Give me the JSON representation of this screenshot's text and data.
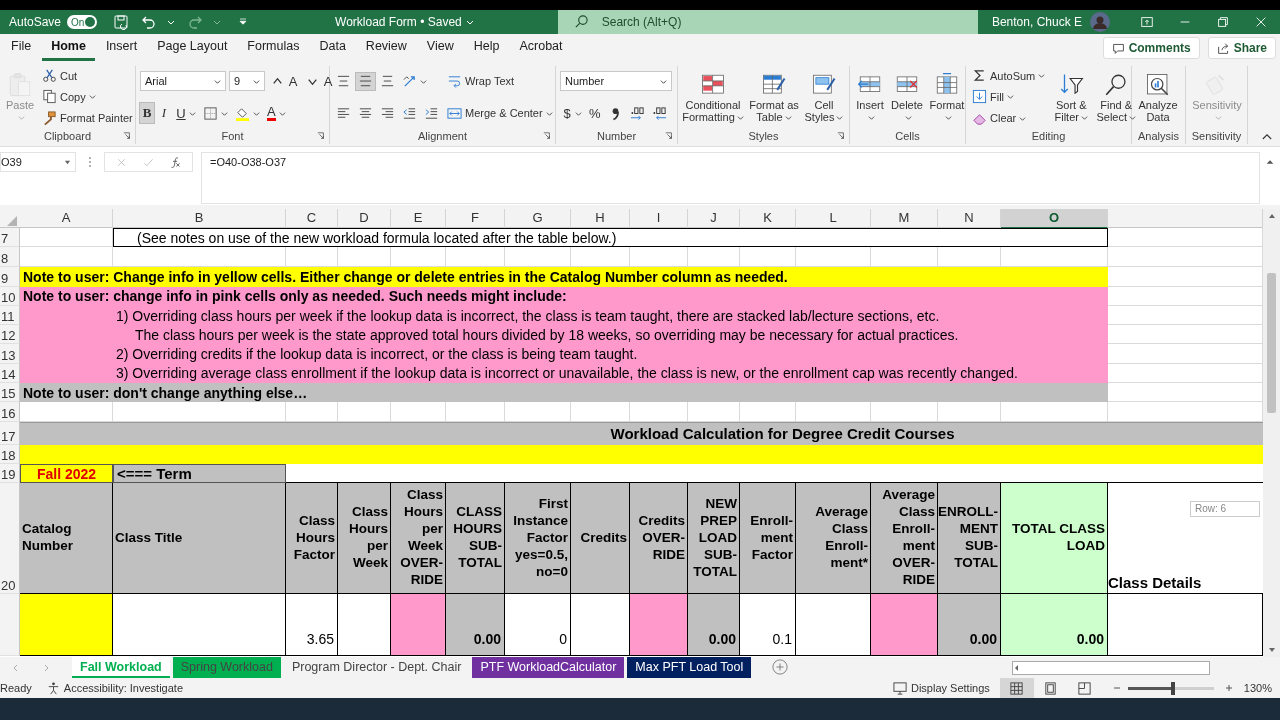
{
  "title_bar": {
    "autosave_label": "AutoSave",
    "autosave": {
      "on": true,
      "label": "On"
    },
    "title": "Workload Form • Saved",
    "search": {
      "placeholder": "Search (Alt+Q)"
    },
    "user": "Benton, Chuck E"
  },
  "menu_tabs": [
    {
      "label": "File",
      "selected": false
    },
    {
      "label": "Home",
      "selected": true
    },
    {
      "label": "Insert",
      "selected": false
    },
    {
      "label": "Page Layout",
      "selected": false
    },
    {
      "label": "Formulas",
      "selected": false
    },
    {
      "label": "Data",
      "selected": false
    },
    {
      "label": "Review",
      "selected": false
    },
    {
      "label": "View",
      "selected": false
    },
    {
      "label": "Help",
      "selected": false
    },
    {
      "label": "Acrobat",
      "selected": false
    }
  ],
  "comments": "Comments",
  "share": "Share",
  "ribbon": [
    {
      "label": "Clipboard",
      "launcher": true,
      "columns": [
        [
          [
            {
              "kind": "paste",
              "label": "Paste",
              "disabled": true,
              "menu": true
            }
          ]
        ],
        [
          [
            {
              "kind": "cut",
              "label": "Cut",
              "disabled": false
            }
          ],
          [
            {
              "kind": "copy",
              "label": "Copy",
              "disabled": false,
              "menu": true
            }
          ],
          [
            {
              "kind": "format-painter",
              "label": "Format Painter",
              "disabled": false
            }
          ]
        ]
      ]
    },
    {
      "label": "Font",
      "launcher": true,
      "columns": [
        [
          [
            {
              "kind": "font-name",
              "value": "Arial"
            },
            {
              "kind": "font-size",
              "value": "9"
            },
            {
              "kind": "grow-font",
              "label": "A",
              "disabled": false
            },
            {
              "kind": "shrink-font",
              "label": "A",
              "disabled": false
            }
          ],
          [
            {
              "kind": "bold",
              "label": "B",
              "on": true,
              "disabled": false
            },
            {
              "kind": "italic",
              "label": "I",
              "on": false,
              "disabled": false
            },
            {
              "kind": "underline",
              "label": "U",
              "on": false,
              "disabled": false,
              "menu": true
            },
            {
              "kind": "borders",
              "disabled": false,
              "menu": true
            },
            {
              "kind": "fill-color",
              "disabled": false,
              "menu": true
            },
            {
              "kind": "font-color",
              "label": "A",
              "disabled": false,
              "menu": true
            }
          ]
        ]
      ]
    },
    {
      "label": "Alignment",
      "launcher": true,
      "columns": [
        [
          [
            {
              "kind": "align-top",
              "on": false,
              "disabled": false
            },
            {
              "kind": "align-middle",
              "on": true,
              "disabled": false
            },
            {
              "kind": "align-bottom",
              "on": false,
              "disabled": false
            },
            {
              "kind": "orientation",
              "disabled": false,
              "menu": true
            }
          ],
          [
            {
              "kind": "align-left",
              "on": false,
              "disabled": false
            },
            {
              "kind": "align-center",
              "on": false,
              "disabled": false
            },
            {
              "kind": "align-right",
              "on": false,
              "disabled": false
            },
            {
              "kind": "decrease-indent",
              "disabled": false
            },
            {
              "kind": "increase-indent",
              "disabled": false
            }
          ]
        ],
        [
          [
            {
              "kind": "wrap-text",
              "label": "Wrap Text",
              "disabled": false
            }
          ],
          [
            {
              "kind": "merge-center",
              "label": "Merge & Center",
              "disabled": false,
              "menu": true
            }
          ]
        ]
      ]
    },
    {
      "label": "Number",
      "launcher": true,
      "columns": [
        [
          [
            {
              "kind": "number-format",
              "value": "Number"
            }
          ],
          [
            {
              "kind": "currency",
              "label": "$",
              "disabled": false,
              "menu": true
            },
            {
              "kind": "percent",
              "label": "%",
              "disabled": false
            },
            {
              "kind": "comma-style",
              "disabled": false
            },
            {
              "kind": "increase-decimal",
              "disabled": false
            },
            {
              "kind": "decrease-decimal",
              "disabled": false
            }
          ]
        ]
      ]
    },
    {
      "label": "Styles",
      "launcher": true,
      "columns": [
        [
          [
            {
              "kind": "conditional-formatting",
              "label": "Conditional Formatting",
              "disabled": false,
              "menu": true
            }
          ]
        ],
        [
          [
            {
              "kind": "format-as-table",
              "label": "Format as Table",
              "disabled": false,
              "menu": true
            }
          ]
        ],
        [
          [
            {
              "kind": "cell-styles",
              "label": "Cell Styles",
              "disabled": false,
              "menu": true
            }
          ]
        ]
      ]
    },
    {
      "label": "Cells",
      "columns": [
        [
          [
            {
              "kind": "insert",
              "label": "Insert",
              "disabled": false,
              "menu": true
            }
          ]
        ],
        [
          [
            {
              "kind": "delete",
              "label": "Delete",
              "disabled": false,
              "menu": true
            }
          ]
        ],
        [
          [
            {
              "kind": "format",
              "label": "Format",
              "disabled": false,
              "menu": true
            }
          ]
        ]
      ]
    },
    {
      "label": "Editing",
      "columns": [
        [
          [
            {
              "kind": "autosum",
              "label": "AutoSum",
              "disabled": false,
              "menu": true
            }
          ],
          [
            {
              "kind": "fill",
              "label": "Fill",
              "disabled": false,
              "menu": true
            }
          ],
          [
            {
              "kind": "clear",
              "label": "Clear",
              "disabled": false,
              "menu": true
            }
          ]
        ],
        [
          [
            {
              "kind": "sort-filter",
              "label": "Sort & Filter",
              "disabled": false,
              "menu": true
            }
          ]
        ],
        [
          [
            {
              "kind": "find-select",
              "label": "Find & Select",
              "disabled": false,
              "menu": true
            }
          ]
        ]
      ]
    },
    {
      "label": "Analysis",
      "columns": [
        [
          [
            {
              "kind": "analyze-data",
              "label": "Analyze Data",
              "disabled": false
            }
          ]
        ]
      ]
    },
    {
      "label": "Sensitivity",
      "columns": [
        [
          [
            {
              "kind": "sensitivity",
              "label": "Sensitivity",
              "disabled": true,
              "menu": true
            }
          ]
        ]
      ]
    }
  ],
  "formula_bar": {
    "name_box": "O39",
    "formula": "=O40-O38-O37"
  },
  "columns": [
    {
      "label": "A",
      "selected": false
    },
    {
      "label": "B",
      "selected": false
    },
    {
      "label": "C",
      "selected": false
    },
    {
      "label": "D",
      "selected": false
    },
    {
      "label": "E",
      "selected": false
    },
    {
      "label": "F",
      "selected": false
    },
    {
      "label": "G",
      "selected": false
    },
    {
      "label": "H",
      "selected": false
    },
    {
      "label": "I",
      "selected": false
    },
    {
      "label": "J",
      "selected": false
    },
    {
      "label": "K",
      "selected": false
    },
    {
      "label": "L",
      "selected": false
    },
    {
      "label": "M",
      "selected": false
    },
    {
      "label": "N",
      "selected": false
    },
    {
      "label": "O",
      "selected": true
    }
  ],
  "rows": [
    {
      "num": "7",
      "cells": [
        {
          "kind": "white"
        },
        {
          "kind": "boxed",
          "text": "(See notes on use of the new workload formula located after the table below.)"
        }
      ]
    },
    {
      "num": "8"
    },
    {
      "num": "9",
      "cells": [
        {
          "kind": "note-yellow",
          "text": "Note to user: Change info in yellow cells.  Either change or delete entries in the Catalog Number column as needed."
        }
      ]
    },
    {
      "num": "10",
      "cells": [
        {
          "kind": "note-pink",
          "text": "Note to user: change info in pink cells only as needed.  Such needs might include:"
        }
      ]
    },
    {
      "num": "11",
      "cells": [
        {
          "kind": "pink"
        },
        {
          "kind": "pink-text",
          "text": "1) Overriding class hours per week if the lookup data is incorrect, the class is team taught, there are stacked lab/lecture sections, etc."
        }
      ]
    },
    {
      "num": "12",
      "cells": [
        {
          "kind": "pink"
        },
        {
          "kind": "pink-text-indent",
          "text": "The class hours per week is the state approved total hours divided by 18 weeks, so overriding may be necessary for actual practices."
        }
      ]
    },
    {
      "num": "13",
      "cells": [
        {
          "kind": "pink"
        },
        {
          "kind": "pink-text",
          "text": "2) Overriding credits if the lookup data is incorrect, or the class is being team taught."
        }
      ]
    },
    {
      "num": "14",
      "cells": [
        {
          "kind": "pink"
        },
        {
          "kind": "pink-text",
          "text": "3) Overriding average class enrollment if the lookup data is incorrect or unavailable, the class is new, or the enrollment cap was recently changed."
        }
      ]
    },
    {
      "num": "15",
      "cells": [
        {
          "kind": "note-grey",
          "text": "Note to user: don't change anything else…"
        }
      ]
    },
    {
      "num": "16"
    },
    {
      "num": "17",
      "cells": [
        {
          "kind": "banner",
          "text": "Workload Calculation for Degree Credit Courses"
        }
      ]
    },
    {
      "num": "18",
      "cells": [
        {
          "kind": "band-yellow"
        }
      ]
    },
    {
      "num": "19",
      "cells": [
        {
          "kind": "term",
          "text": "Fall 2022"
        },
        {
          "kind": "label-grey",
          "text": "<=== Term"
        },
        {
          "kind": "blank-rest"
        }
      ]
    },
    {
      "num": "20",
      "cells": [
        {
          "kind": "head-left",
          "text": "Catalog Number"
        },
        {
          "kind": "head-left",
          "text": "Class Title"
        },
        {
          "kind": "head",
          "text": "Class Hours Factor"
        },
        {
          "kind": "head",
          "text": "Class Hours per Week"
        },
        {
          "kind": "head",
          "text": "Class Hours per Week OVER-RIDE"
        },
        {
          "kind": "head",
          "text": "CLASS HOURS SUB-TOTAL"
        },
        {
          "kind": "head",
          "text": "First Instance Factor yes=0.5, no=0"
        },
        {
          "kind": "head",
          "text": "Credits"
        },
        {
          "kind": "head",
          "text": "Credits OVER-RIDE"
        },
        {
          "kind": "head",
          "text": "NEW PREP LOAD SUB-TOTAL"
        },
        {
          "kind": "head",
          "text": "Enroll-ment Factor"
        },
        {
          "kind": "head",
          "text": "Average Class Enroll-ment*"
        },
        {
          "kind": "head",
          "text": "Average Class Enroll-ment OVER-RIDE"
        },
        {
          "kind": "head",
          "text": "ENROLL-MENT SUB-TOTAL"
        },
        {
          "kind": "head-total",
          "text": "TOTAL CLASS LOAD"
        },
        {
          "kind": "head-details",
          "text": "Class Details"
        }
      ]
    },
    {
      "cells": [
        {
          "kind": "yellow"
        },
        {
          "kind": "data"
        },
        {
          "kind": "data",
          "text": "3.65"
        },
        {
          "kind": "data"
        },
        {
          "kind": "pink-data"
        },
        {
          "kind": "sub",
          "text": "0.00"
        },
        {
          "kind": "data",
          "text": "0"
        },
        {
          "kind": "data"
        },
        {
          "kind": "pink-data"
        },
        {
          "kind": "sub",
          "text": "0.00"
        },
        {
          "kind": "data",
          "text": "0.1"
        },
        {
          "kind": "data"
        },
        {
          "kind": "pink-data"
        },
        {
          "kind": "sub",
          "text": "0.00"
        },
        {
          "kind": "total",
          "text": "0.00"
        },
        {
          "kind": "data"
        }
      ]
    }
  ],
  "row_tooltip": "Row: 6",
  "sheet_tabs": [
    {
      "label": "Fall Workload",
      "selected": true,
      "color": "#00b050"
    },
    {
      "label": "Spring Workload",
      "selected": false,
      "color": "#00b050"
    },
    {
      "label": "Program Director - Dept. Chair",
      "selected": false
    },
    {
      "label": "PTF WorkloadCalculator",
      "selected": false,
      "color": "#7030a0"
    },
    {
      "label": "Max PFT Load Tool",
      "selected": false,
      "color": "#002060"
    }
  ],
  "status_bar": {
    "ready": "Ready",
    "accessibility": "Accessibility: Investigate",
    "display_settings": "Display Settings",
    "views": [
      {
        "kind": "normal",
        "selected": true
      },
      {
        "kind": "page-layout",
        "selected": false
      },
      {
        "kind": "page-break",
        "selected": false
      }
    ],
    "zoom": {
      "level": 0.52,
      "label": "130%"
    }
  }
}
